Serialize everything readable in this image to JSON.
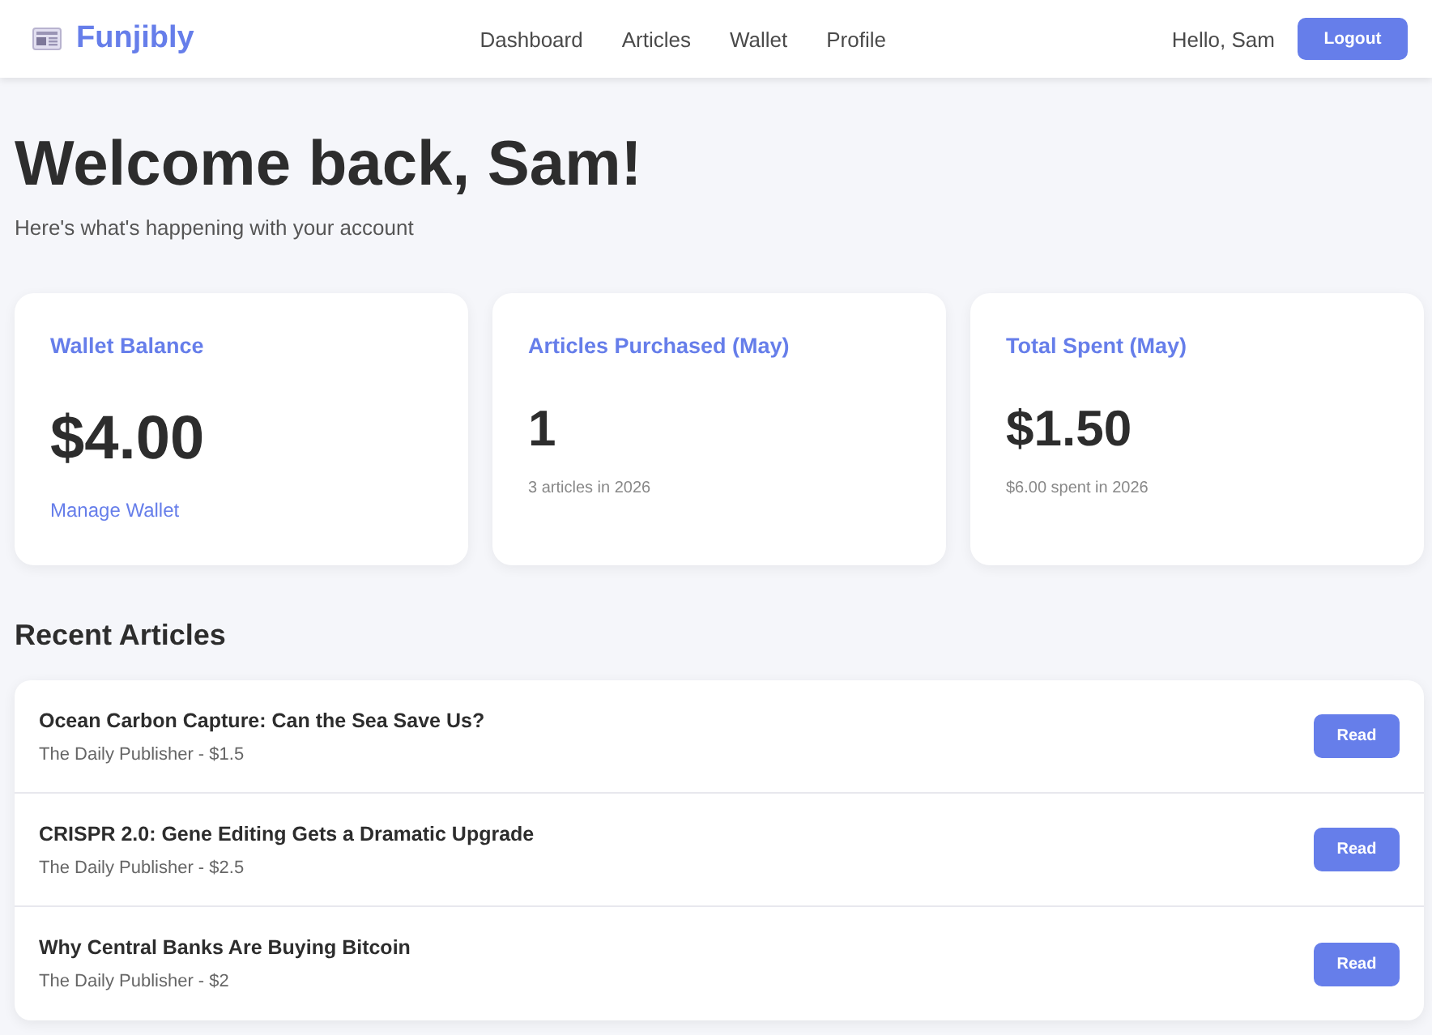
{
  "navbar": {
    "brand": "Funjibly",
    "links": [
      "Dashboard",
      "Articles",
      "Wallet",
      "Profile"
    ],
    "greeting": "Hello, Sam",
    "logout": "Logout"
  },
  "header": {
    "title": "Welcome back, Sam!",
    "subtitle": "Here's what's happening with your account"
  },
  "stats": [
    {
      "kind": "balance",
      "label": "Wallet Balance",
      "value": "$4.00",
      "link": "Manage Wallet"
    },
    {
      "kind": "stat",
      "label": "Articles Purchased (May)",
      "value": "1",
      "note": "3 articles in 2026"
    },
    {
      "kind": "stat",
      "label": "Total Spent (May)",
      "value": "$1.50",
      "note": "$6.00 spent in 2026"
    }
  ],
  "recent": {
    "title": "Recent Articles",
    "articles": [
      {
        "title": "Ocean Carbon Capture: Can the Sea Save Us?",
        "meta": "The Daily Publisher - $1.5",
        "action": "Read"
      },
      {
        "title": "CRISPR 2.0: Gene Editing Gets a Dramatic Upgrade",
        "meta": "The Daily Publisher - $2.5",
        "action": "Read"
      },
      {
        "title": "Why Central Banks Are Buying Bitcoin",
        "meta": "The Daily Publisher - $2",
        "action": "Read"
      }
    ]
  }
}
